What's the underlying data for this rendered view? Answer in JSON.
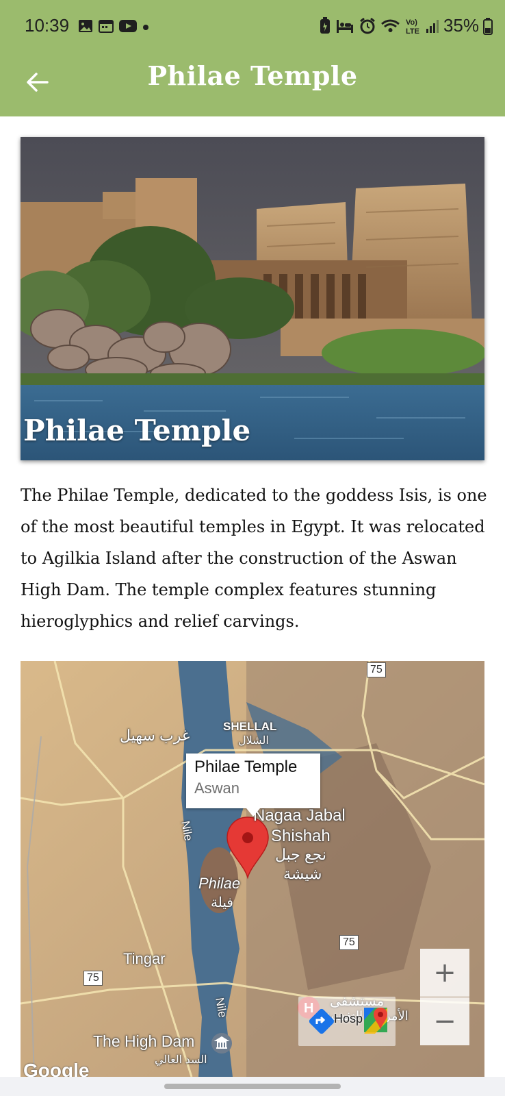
{
  "status_bar": {
    "time": "10:39",
    "battery": "35%",
    "left_icons": [
      "image-icon",
      "calendar-icon",
      "youtube-icon",
      "dot-icon"
    ],
    "right_icons": [
      "battery-saver-icon",
      "bed-icon",
      "alarm-icon",
      "wifi-icon",
      "volte-icon",
      "signal-icon",
      "battery-icon"
    ],
    "volte_text": "Vo)\nLTE"
  },
  "app_bar": {
    "title": "Philae Temple",
    "back_icon": "arrow-left-icon",
    "color": "#9bbb6d"
  },
  "hero": {
    "caption": "Philae Temple"
  },
  "description": "The Philae Temple, dedicated to the goddess Isis, is one of the most beautiful temples in Egypt. It was relocated to Agilkia Island after the construction of the Aswan High Dam. The temple complex features stunning hieroglyphics and relief carvings.",
  "map": {
    "info_window": {
      "title": "Philae Temple",
      "subtitle": "Aswan"
    },
    "labels": {
      "gharb_suhayl": "غرب سهيل",
      "shellal": "SHELLAL",
      "shellal_ar": "الشلال",
      "nagaa_1": "Nagaa Jabal",
      "nagaa_2": "Shishah",
      "nagaa_ar1": "نجع جبل",
      "nagaa_ar2": "شيشة",
      "nile_1": "Nile",
      "nile_2": "Nile",
      "philae": "Philae",
      "philae_ar": "فيلة",
      "tingar": "Tingar",
      "high_dam": "The High Dam",
      "high_dam_ar": "السد العالي",
      "hospital_ar1": "مستشفى",
      "hospital_ar2": "الأمراض النفسية",
      "hosp": "Hosp",
      "google": "Google"
    },
    "road_shields": [
      "75",
      "75",
      "75"
    ],
    "zoom_in": "+",
    "zoom_out": "−",
    "marker_color": "#e53935"
  }
}
